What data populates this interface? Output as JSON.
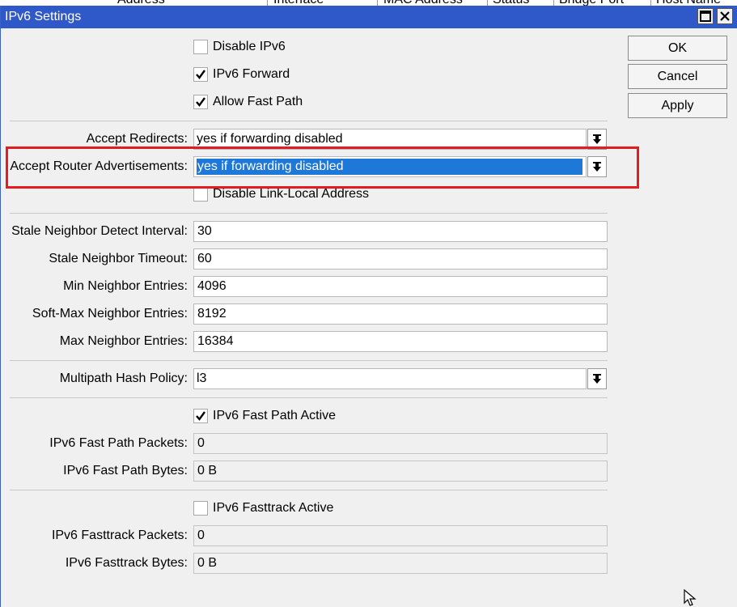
{
  "background_table": {
    "columns": [
      "Address",
      "Interface",
      "MAC Address",
      "Status",
      "Bridge Port",
      "Host Name"
    ]
  },
  "window": {
    "title": "IPv6 Settings"
  },
  "buttons": {
    "ok": "OK",
    "cancel": "Cancel",
    "apply": "Apply"
  },
  "checkboxes": {
    "disable_ipv6": {
      "label": "Disable IPv6",
      "checked": false
    },
    "ipv6_forward": {
      "label": "IPv6 Forward",
      "checked": true
    },
    "allow_fast_path": {
      "label": "Allow Fast Path",
      "checked": true
    },
    "disable_link_local": {
      "label": "Disable Link-Local Address",
      "checked": false
    },
    "fast_path_active": {
      "label": "IPv6 Fast Path Active",
      "checked": true
    },
    "fasttrack_active": {
      "label": "IPv6 Fasttrack Active",
      "checked": false
    }
  },
  "fields": {
    "accept_redirects": {
      "label": "Accept Redirects:",
      "value": "yes if forwarding disabled"
    },
    "accept_router_adv": {
      "label": "Accept Router Advertisements:",
      "value": "yes if forwarding disabled"
    },
    "stale_detect_interval": {
      "label": "Stale Neighbor Detect Interval:",
      "value": "30"
    },
    "stale_timeout": {
      "label": "Stale Neighbor Timeout:",
      "value": "60"
    },
    "min_entries": {
      "label": "Min Neighbor Entries:",
      "value": "4096"
    },
    "softmax_entries": {
      "label": "Soft-Max Neighbor Entries:",
      "value": "8192"
    },
    "max_entries": {
      "label": "Max Neighbor Entries:",
      "value": "16384"
    },
    "multipath_hash": {
      "label": "Multipath Hash Policy:",
      "value": "l3"
    },
    "fast_path_packets": {
      "label": "IPv6 Fast Path Packets:",
      "value": "0"
    },
    "fast_path_bytes": {
      "label": "IPv6 Fast Path Bytes:",
      "value": "0 B"
    },
    "fasttrack_packets": {
      "label": "IPv6 Fasttrack Packets:",
      "value": "0"
    },
    "fasttrack_bytes": {
      "label": "IPv6 Fasttrack Bytes:",
      "value": "0 B"
    }
  },
  "colors": {
    "titlebar": "#2f58c8",
    "selection": "#1e78d7",
    "highlight": "#e31b23"
  }
}
